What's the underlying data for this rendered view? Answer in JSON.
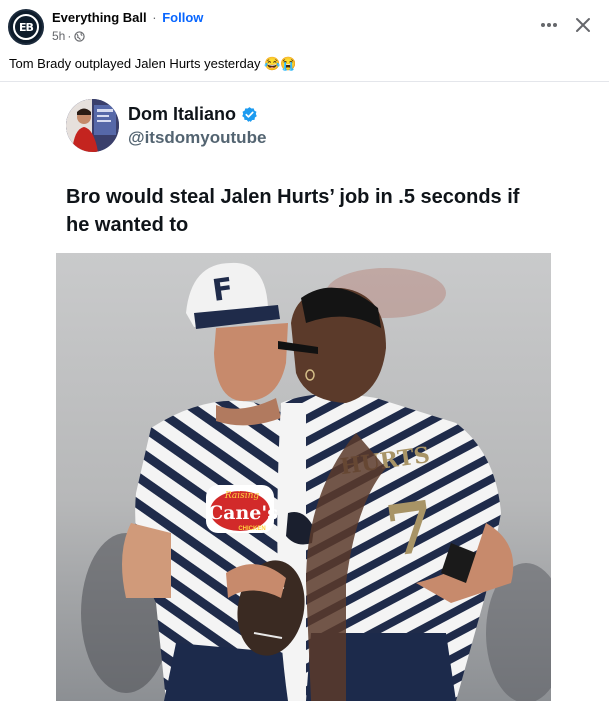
{
  "post": {
    "page_name": "Everything Ball",
    "separator": "·",
    "follow_label": "Follow",
    "time": "5h",
    "time_sep": "·",
    "caption": "Tom Brady outplayed Jalen Hurts yesterday 😂😭",
    "avatar_text": "EB"
  },
  "tweet": {
    "display_name": "Dom Italiano",
    "handle": "@itsdomyoutube",
    "text": "Bro would steal Jalen Hurts’ job in .5 seconds if he wanted to"
  },
  "photo": {
    "cap_logo_text": "F",
    "jersey_back_name": "HURTS",
    "jersey_number": "7",
    "sponsor_top": "Raising",
    "sponsor_main": "Cane's",
    "sponsor_bottom": "CHICKEN"
  },
  "colors": {
    "accent": "#0866ff",
    "text_primary": "#050505",
    "text_secondary": "#65676b",
    "verified": "#1d9bf0"
  },
  "icons": {
    "more": "more-horizontal-icon",
    "close": "close-icon",
    "audience": "globe-icon",
    "verified": "verified-badge-icon"
  }
}
